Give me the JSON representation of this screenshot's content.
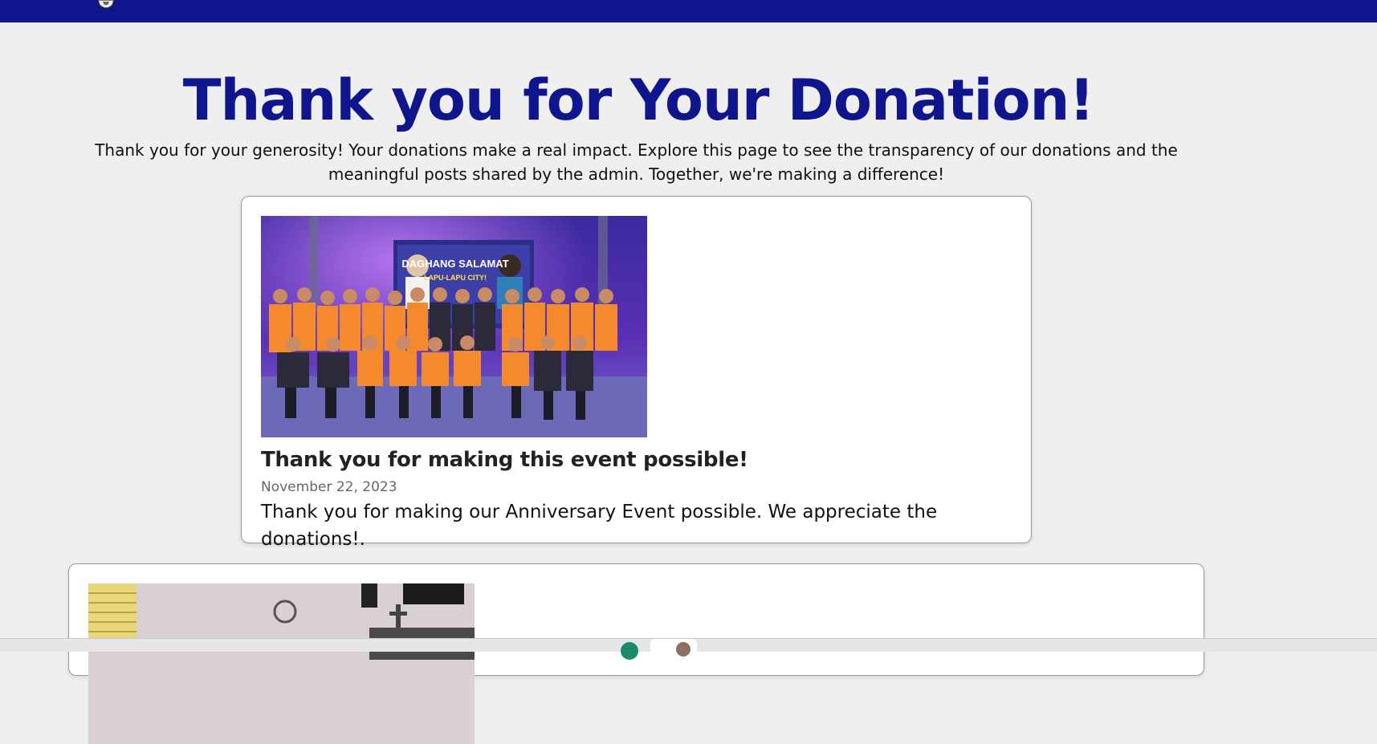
{
  "header": {
    "logo_icon": "shield-logo-icon",
    "bar_color": "#0e158d"
  },
  "page": {
    "title": "Thank you for Your Donation!",
    "intro": "Thank you for your generosity! Your donations make a real impact. Explore this page to see the transparency of our donations and the meaningful posts shared by the admin. Together, we're making a difference!"
  },
  "posts": [
    {
      "image_alt": "Group photo of volunteers on stage in front of a screen reading DAGHANG SALAMAT LAPU-LAPU CITY!",
      "image_screen_text": "DAGHANG SALAMAT",
      "image_screen_subtext": "LAPU-LAPU CITY!",
      "title": "Thank you for making this event possible!",
      "date": "November 22, 2023",
      "body": "Thank you for making our Anniversary Event possible. We appreciate the donations!."
    },
    {
      "image_alt": "Room interior with window, wall fan, speaker and television"
    }
  ],
  "colors": {
    "accent": "#0e158d",
    "background": "#efefef"
  }
}
